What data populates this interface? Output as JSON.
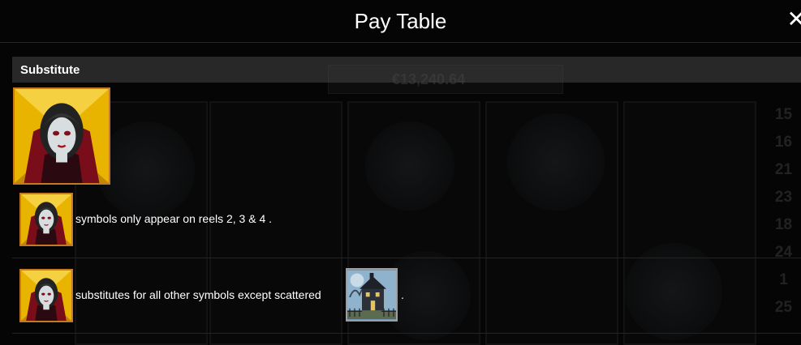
{
  "header": {
    "title": "Pay Table",
    "close_icon": "close-icon"
  },
  "section": {
    "title": "Substitute"
  },
  "rows": [
    {
      "text": "symbols only appear on reels 2, 3 & 4 ."
    },
    {
      "text": "substitutes for all other symbols except scattered",
      "suffix": "."
    }
  ],
  "background": {
    "jackpot": "€13,240.64",
    "numbers": [
      "15",
      "16",
      "21",
      "23",
      "18",
      "24",
      "1",
      "25"
    ]
  },
  "colors": {
    "tile_border": "#c77823",
    "section_bg": "#464646"
  }
}
